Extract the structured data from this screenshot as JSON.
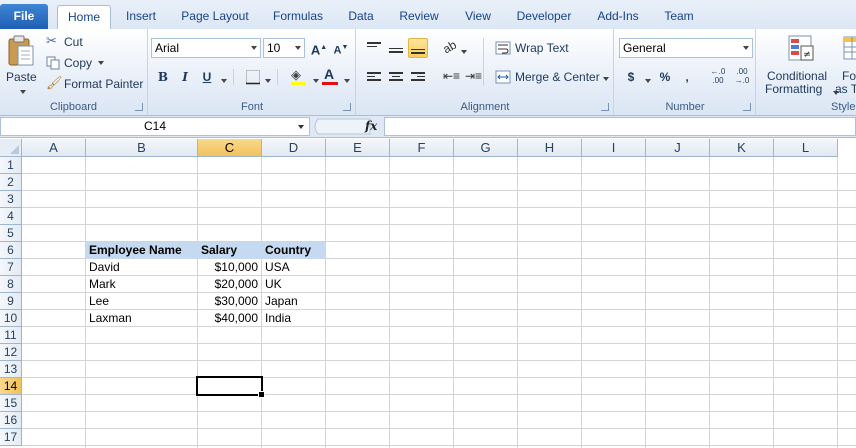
{
  "tabs": [
    "File",
    "Home",
    "Insert",
    "Page Layout",
    "Formulas",
    "Data",
    "Review",
    "View",
    "Developer",
    "Add-Ins",
    "Team"
  ],
  "ribbon": {
    "clipboard": {
      "label": "Clipboard",
      "paste": "Paste",
      "cut": "Cut",
      "copy": "Copy",
      "format_painter": "Format Painter"
    },
    "font": {
      "label": "Font",
      "name": "Arial",
      "size": "10",
      "grow": "A",
      "shrink": "A",
      "bold": "B",
      "italic": "I",
      "underline": "U",
      "font_color": "A",
      "font_color_hex": "#e01010",
      "fill_color_hex": "#ffff00"
    },
    "alignment": {
      "label": "Alignment",
      "wrap_text": "Wrap Text",
      "merge_center": "Merge & Center"
    },
    "number": {
      "label": "Number",
      "format": "General",
      "currency": "$",
      "percent": "%",
      "comma": ",",
      "increase_decimal": ".0→.00",
      "decrease_decimal": ".00→.0"
    },
    "styles": {
      "label": "Style",
      "conditional_1": "Conditional",
      "conditional_2": "Formatting",
      "format_table_1": "For",
      "format_table_2": "as Ta"
    }
  },
  "formula_bar": {
    "name_box": "C14",
    "fx": "fx",
    "value": ""
  },
  "columns": [
    "A",
    "B",
    "C",
    "D",
    "E",
    "F",
    "G",
    "H",
    "I",
    "J",
    "K",
    "L"
  ],
  "rows": [
    "1",
    "2",
    "3",
    "4",
    "5",
    "6",
    "7",
    "8",
    "9",
    "10",
    "11",
    "12",
    "13",
    "14",
    "15",
    "16",
    "17"
  ],
  "active": {
    "column": "C",
    "row": "14"
  },
  "table": {
    "headers": [
      "Employee Name",
      "Salary",
      "Country"
    ],
    "data": [
      [
        "David",
        "$10,000",
        "USA"
      ],
      [
        "Mark",
        "$20,000",
        "UK"
      ],
      [
        "Lee",
        "$30,000",
        "Japan"
      ],
      [
        "Laxman",
        "$40,000",
        "India"
      ]
    ]
  }
}
